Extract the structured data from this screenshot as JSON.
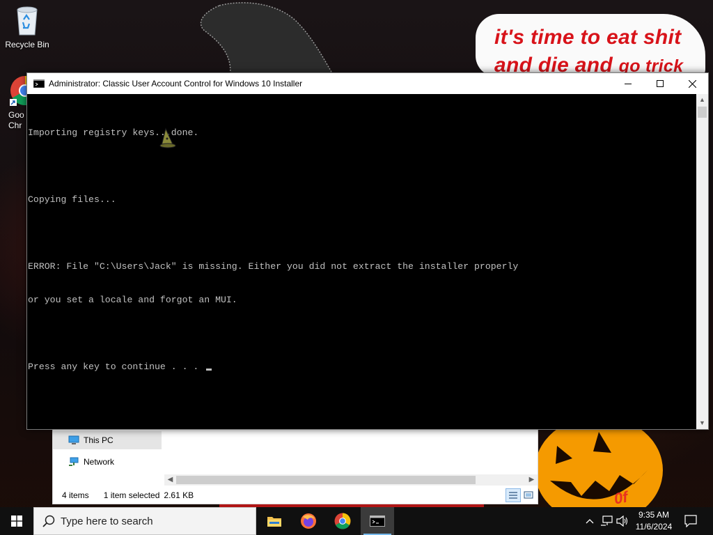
{
  "desktop": {
    "icons": [
      {
        "label": "Recycle Bin",
        "icon": "recycle-bin-icon"
      },
      {
        "label_line1": "Goo",
        "label_line2": "Chr",
        "icon": "chrome-icon"
      }
    ],
    "wallpaper_text": {
      "line1": "it's time to eat shit",
      "line2_big": "and die and ",
      "line2_small": "go trick",
      "corner": "0f"
    }
  },
  "console": {
    "title": "Administrator:  Classic User Account Control for Windows 10 Installer",
    "lines": [
      "Importing registry keys...done.",
      "",
      "Copying files...",
      "",
      "ERROR: File \"C:\\Users\\Jack\" is missing. Either you did not extract the installer properly",
      "or you set a locale and forgot an MUI.",
      "",
      "Press any key to continue . . . "
    ],
    "controls": {
      "minimize": "minimize-icon",
      "maximize": "maximize-icon",
      "close": "close-icon"
    }
  },
  "explorer": {
    "nav_items": [
      {
        "label": "This PC",
        "icon": "computer-icon",
        "selected": true
      },
      {
        "label": "Network",
        "icon": "network-icon",
        "selected": false
      }
    ],
    "status": {
      "items": "4 items",
      "selected": "1 item selected",
      "size": "2.61 KB"
    }
  },
  "taskbar": {
    "search_placeholder": "Type here to search",
    "apps": [
      {
        "name": "File Explorer",
        "icon": "folder-icon"
      },
      {
        "name": "Firefox",
        "icon": "firefox-icon"
      },
      {
        "name": "Google Chrome",
        "icon": "chrome-icon"
      },
      {
        "name": "Command Prompt",
        "icon": "cmd-icon",
        "active": true
      }
    ],
    "tray": {
      "icons": [
        "chevron-up-icon",
        "network-icon",
        "volume-icon"
      ]
    },
    "clock": {
      "time": "9:35 AM",
      "date": "11/6/2024"
    },
    "notifications_icon": "notification-icon"
  },
  "colors": {
    "console_bg": "#000000",
    "console_fg": "#c0c0c0",
    "taskbar_bg": "#101010",
    "sign_text": "#d8131a",
    "accent": "#76b9ed"
  }
}
